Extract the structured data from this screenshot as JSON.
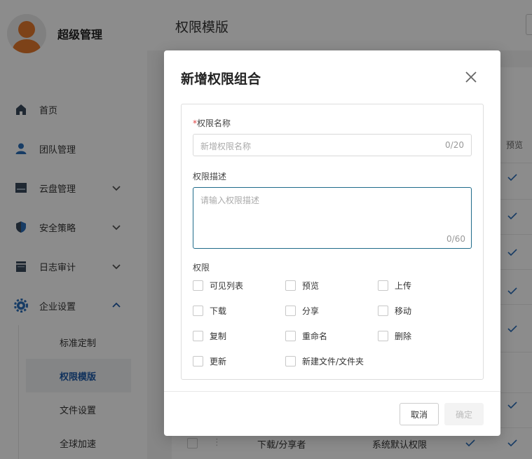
{
  "app": {
    "username": "超级管理",
    "page_title": "权限模版"
  },
  "sidebar": {
    "items": [
      {
        "label": "首页",
        "icon": "home-icon"
      },
      {
        "label": "团队管理",
        "icon": "user-icon"
      },
      {
        "label": "云盘管理",
        "icon": "cloud-drive-icon"
      },
      {
        "label": "安全策略",
        "icon": "shield-icon"
      },
      {
        "label": "日志审计",
        "icon": "log-icon"
      },
      {
        "label": "企业设置",
        "icon": "gear-icon"
      }
    ],
    "subitems": [
      "标准定制",
      "权限模版",
      "文件设置",
      "全球加速"
    ],
    "active_subitem": "权限模版"
  },
  "table": {
    "column_preview": "预览",
    "bottom_row": {
      "name": "下载/分享者",
      "type": "系统默认权限"
    }
  },
  "modal": {
    "title": "新增权限组合",
    "name_label_required": "*",
    "name_label": "权限名称",
    "name_placeholder": "新增权限名称",
    "name_counter": "0/20",
    "desc_label": "权限描述",
    "desc_placeholder": "请输入权限描述",
    "desc_counter": "0/60",
    "perm_label": "权限",
    "permissions": [
      "可见列表",
      "预览",
      "上传",
      "下载",
      "分享",
      "移动",
      "复制",
      "重命名",
      "删除",
      "更新",
      "新建文件/文件夹"
    ],
    "cancel_label": "取消",
    "ok_label": "确定"
  },
  "colors": {
    "accent": "#1e5aa8",
    "avatar": "#e3782c",
    "check": "#2a6db8",
    "required": "#e04545"
  }
}
